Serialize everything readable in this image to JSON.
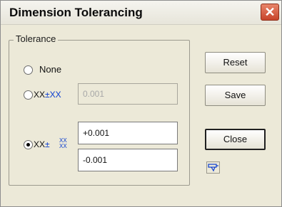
{
  "window": {
    "title": "Dimension Tolerancing",
    "close_glyph": "✕"
  },
  "tolerance_group": {
    "legend": "Tolerance",
    "options": [
      {
        "label": "None",
        "selected": false
      },
      {
        "label_xx": "XX",
        "label_pm": "±",
        "label_xx2": "XX",
        "selected": false,
        "value": "0.001"
      },
      {
        "label_xx": "XX",
        "label_pm": "±",
        "upper_xx": "XX",
        "lower_xx": "XX",
        "selected": true,
        "upper_value": "+0.001",
        "lower_value": "-0.001"
      }
    ]
  },
  "buttons": {
    "reset": "Reset",
    "save": "Save",
    "close": "Close"
  },
  "icons": {
    "help": "pen-tool-icon"
  }
}
